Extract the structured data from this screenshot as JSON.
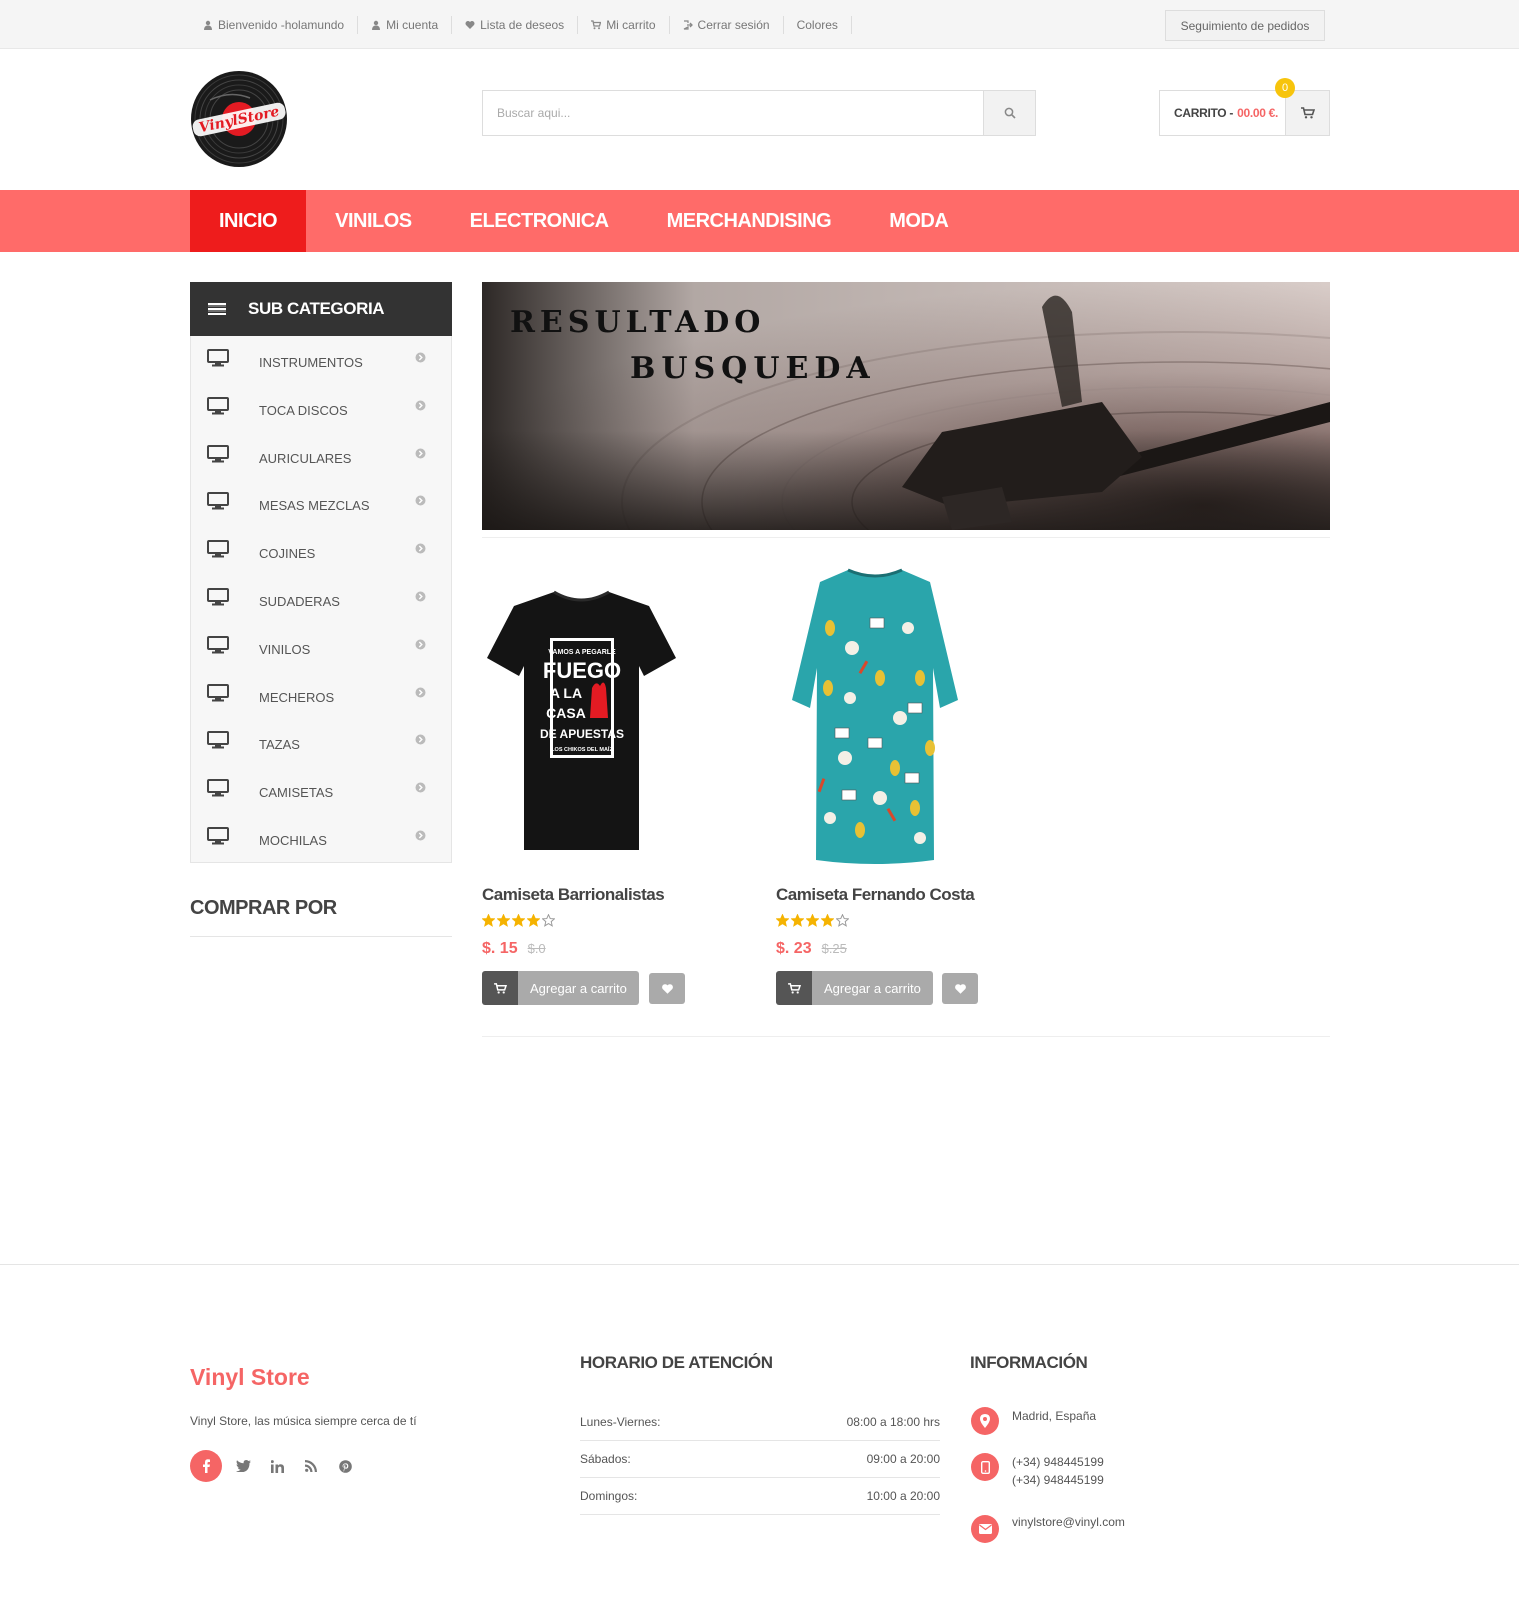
{
  "topbar": {
    "links": [
      {
        "label": "Bienvenido -holamundo",
        "icon": "user-icon"
      },
      {
        "label": "Mi cuenta",
        "icon": "user-icon"
      },
      {
        "label": "Lista de deseos",
        "icon": "heart-icon"
      },
      {
        "label": "Mi carrito",
        "icon": "cart-icon"
      },
      {
        "label": "Cerrar sesión",
        "icon": "signout-icon"
      },
      {
        "label": "Colores",
        "icon": ""
      }
    ],
    "track_orders": "Seguimiento de pedidos"
  },
  "header": {
    "logo_text": "VinylStore",
    "search_placeholder": "Buscar aqui...",
    "cart_label": "CARRITO -",
    "cart_amount": "00.00 €.",
    "cart_count": "0"
  },
  "nav": {
    "items": [
      "INICIO",
      "VINILOS",
      "ELECTRONICA",
      "MERCHANDISING",
      "MODA"
    ],
    "active": "INICIO"
  },
  "sidebar": {
    "title": "SUB CATEGORIA",
    "items": [
      "INSTRUMENTOS",
      "TOCA DISCOS",
      "AURICULARES",
      "MESAS MEZCLAS",
      "COJINES",
      "SUDADERAS",
      "VINILOS",
      "MECHEROS",
      "TAZAS",
      "CAMISETAS",
      "MOCHILAS"
    ],
    "buy_by": "COMPRAR POR"
  },
  "banner": {
    "line1": "RESULTADO",
    "line2": "BUSQUEDA"
  },
  "products": [
    {
      "name": "Camiseta Barrionalistas",
      "rating": 4,
      "price": "$. 15",
      "old_price": "$.0",
      "add_label": "Agregar a carrito",
      "shirt_text": [
        "VAMOS A PEGARLE",
        "FUEGO",
        "A LA",
        "CASA",
        "DE APUESTAS",
        "LOS CHIKOS DEL MAÍZ"
      ]
    },
    {
      "name": "Camiseta Fernando Costa",
      "rating": 4,
      "price": "$. 23",
      "old_price": "$.25",
      "add_label": "Agregar a carrito"
    }
  ],
  "footer": {
    "brand": "Vinyl Store",
    "description": "Vinyl Store, las música siempre cerca de tí",
    "socials": [
      "facebook-icon",
      "twitter-icon",
      "linkedin-icon",
      "rss-icon",
      "pinterest-icon"
    ],
    "hours_title": "HORARIO DE ATENCIÓN",
    "hours": [
      {
        "day": "Lunes-Viernes:",
        "time": "08:00 a 18:00 hrs"
      },
      {
        "day": "Sábados:",
        "time": "09:00 a 20:00"
      },
      {
        "day": "Domingos:",
        "time": "10:00 a 20:00"
      }
    ],
    "info_title": "INFORMACIÓN",
    "location": "Madrid, España",
    "phone1": "(+34) 948445199",
    "phone2": "(+34) 948445199",
    "email": "vinylstore@vinyl.com"
  },
  "colors": {
    "accent": "#f56565",
    "nav_bg": "#ff6b69",
    "nav_active": "#ee1c1c",
    "dark": "#333333",
    "badge": "#f7c40c"
  }
}
